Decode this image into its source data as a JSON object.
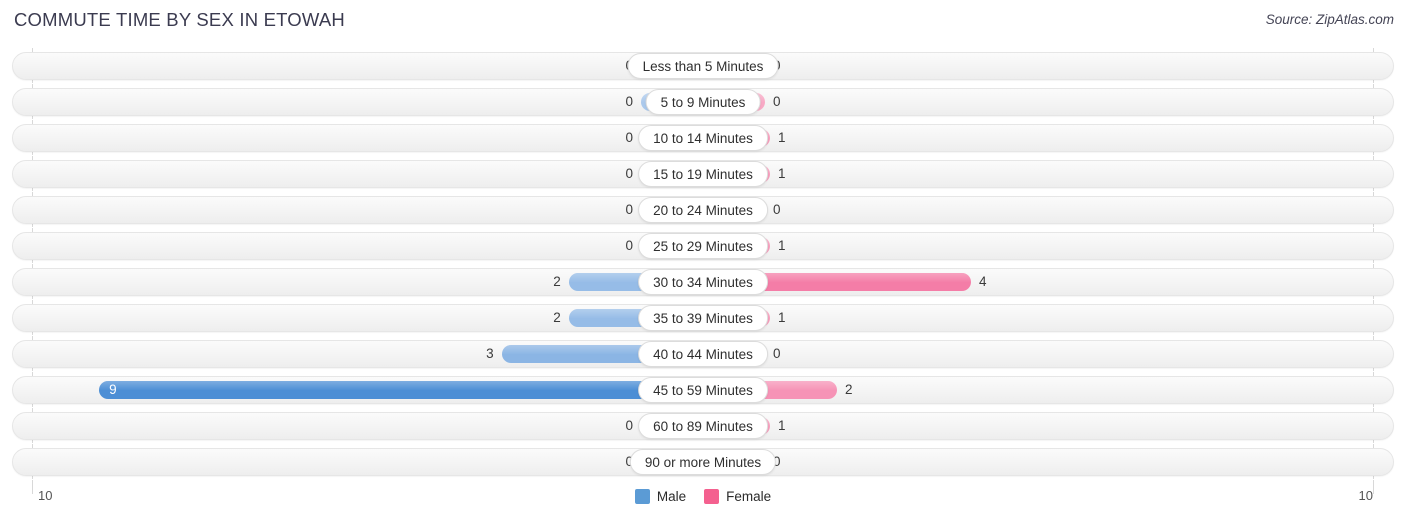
{
  "header": {
    "title": "COMMUTE TIME BY SEX IN ETOWAH",
    "source": "Source: ZipAtlas.com"
  },
  "axis": {
    "left_max": "10",
    "right_max": "10",
    "max_value": 10
  },
  "legend": {
    "items": [
      {
        "label": "Male",
        "color": "#5b9bd5"
      },
      {
        "label": "Female",
        "color": "#f4608f"
      }
    ]
  },
  "chart_data": {
    "type": "bar",
    "orientation": "horizontal-diverging",
    "title": "COMMUTE TIME BY SEX IN ETOWAH",
    "xlabel": "",
    "ylabel": "",
    "xlim": [
      10,
      10
    ],
    "grid": false,
    "legend_position": "bottom-center",
    "categories": [
      "Less than 5 Minutes",
      "5 to 9 Minutes",
      "10 to 14 Minutes",
      "15 to 19 Minutes",
      "20 to 24 Minutes",
      "25 to 29 Minutes",
      "30 to 34 Minutes",
      "35 to 39 Minutes",
      "40 to 44 Minutes",
      "45 to 59 Minutes",
      "60 to 89 Minutes",
      "90 or more Minutes"
    ],
    "series": [
      {
        "name": "Male",
        "side": "left",
        "color": "#5b9bd5",
        "values": [
          0,
          0,
          0,
          0,
          0,
          0,
          2,
          2,
          3,
          9,
          0,
          0
        ]
      },
      {
        "name": "Female",
        "side": "right",
        "color": "#f4608f",
        "values": [
          0,
          0,
          1,
          1,
          0,
          1,
          4,
          1,
          0,
          2,
          1,
          0
        ]
      }
    ]
  },
  "rows": [
    {
      "label": "Less than 5 Minutes",
      "male": "0",
      "female": "0",
      "male_value": 0,
      "female_value": 0
    },
    {
      "label": "5 to 9 Minutes",
      "male": "0",
      "female": "0",
      "male_value": 0,
      "female_value": 0
    },
    {
      "label": "10 to 14 Minutes",
      "male": "0",
      "female": "1",
      "male_value": 0,
      "female_value": 1
    },
    {
      "label": "15 to 19 Minutes",
      "male": "0",
      "female": "1",
      "male_value": 0,
      "female_value": 1
    },
    {
      "label": "20 to 24 Minutes",
      "male": "0",
      "female": "0",
      "male_value": 0,
      "female_value": 0
    },
    {
      "label": "25 to 29 Minutes",
      "male": "0",
      "female": "1",
      "male_value": 0,
      "female_value": 1
    },
    {
      "label": "30 to 34 Minutes",
      "male": "2",
      "female": "4",
      "male_value": 2,
      "female_value": 4
    },
    {
      "label": "35 to 39 Minutes",
      "male": "2",
      "female": "1",
      "male_value": 2,
      "female_value": 1
    },
    {
      "label": "40 to 44 Minutes",
      "male": "3",
      "female": "0",
      "male_value": 3,
      "female_value": 0
    },
    {
      "label": "45 to 59 Minutes",
      "male": "9",
      "female": "2",
      "male_value": 9,
      "female_value": 2
    },
    {
      "label": "60 to 89 Minutes",
      "male": "0",
      "female": "1",
      "male_value": 0,
      "female_value": 1
    },
    {
      "label": "90 or more Minutes",
      "male": "0",
      "female": "0",
      "male_value": 0,
      "female_value": 0
    }
  ]
}
